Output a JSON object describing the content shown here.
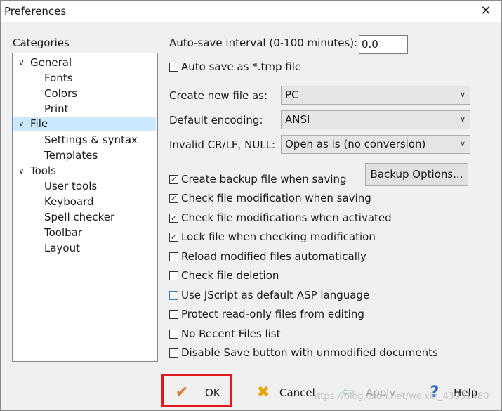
{
  "window": {
    "title": "Preferences",
    "close_glyph": "✕"
  },
  "categories": {
    "label": "Categories",
    "items": [
      {
        "label": "General",
        "twisty": "∨"
      },
      {
        "label": "Fonts"
      },
      {
        "label": "Colors"
      },
      {
        "label": "Print"
      },
      {
        "label": "File",
        "twisty": "∨",
        "selected": true
      },
      {
        "label": "Settings & syntax"
      },
      {
        "label": "Templates"
      },
      {
        "label": "Tools",
        "twisty": "∨"
      },
      {
        "label": "User tools"
      },
      {
        "label": "Keyboard"
      },
      {
        "label": "Spell checker"
      },
      {
        "label": "Toolbar"
      },
      {
        "label": "Layout"
      }
    ]
  },
  "file_settings": {
    "autosave_label": "Auto-save interval (0-100 minutes):",
    "autosave_value": "0.0",
    "tmp_label": "Auto save as *.tmp file",
    "create_new_label": "Create new file as:",
    "create_new_value": "PC",
    "encoding_label": "Default encoding:",
    "encoding_value": "ANSI",
    "invalid_label": "Invalid CR/LF, NULL:",
    "invalid_value": "Open as is (no conversion)",
    "backup_options_button": "Backup Options..."
  },
  "checkboxes": [
    {
      "label": "Create backup file when saving",
      "checked": true
    },
    {
      "label": "Check file modification when saving",
      "checked": true
    },
    {
      "label": "Check file modifications when activated",
      "checked": true
    },
    {
      "label": "Lock file when checking modification",
      "checked": true
    },
    {
      "label": "Reload modified files automatically",
      "checked": false
    },
    {
      "label": "Check file deletion",
      "checked": false
    },
    {
      "label": "Use JScript as default ASP language",
      "checked": false
    },
    {
      "label": "Protect read-only files from editing",
      "checked": false
    },
    {
      "label": "No Recent Files list",
      "checked": false
    },
    {
      "label": "Disable Save button with unmodified documents",
      "checked": false
    }
  ],
  "footer": {
    "ok": "OK",
    "cancel": "Cancel",
    "apply": "Apply",
    "help": "Help",
    "watermark": "https://blog.csdn.net/weixin_43931480"
  },
  "colors": {
    "highlight": "#e0191b",
    "selection": "#cce8ff",
    "ok_check": "#e0712b",
    "cancel_x": "#e8a300",
    "help_q": "#2f6ad0"
  },
  "icons": {
    "ok": "checkmark-icon",
    "cancel": "x-icon",
    "apply": "arrow-icon",
    "help": "question-icon"
  }
}
